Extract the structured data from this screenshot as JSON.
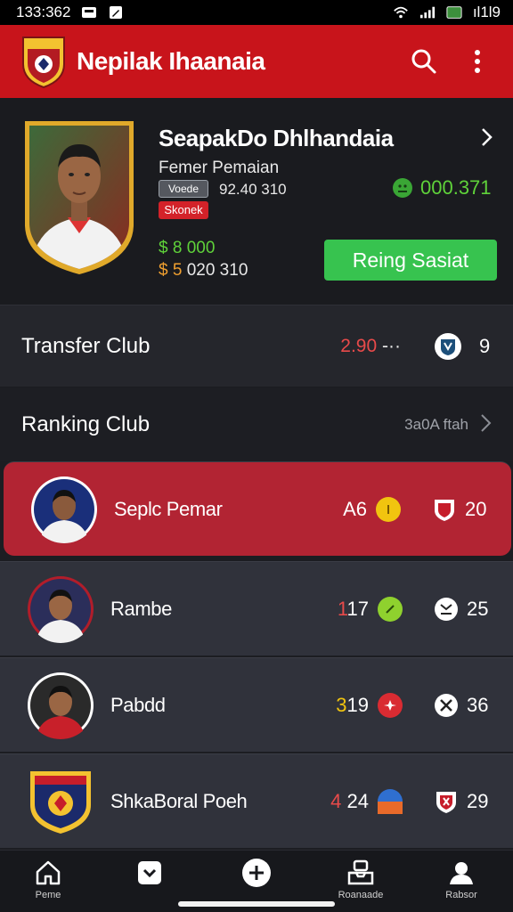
{
  "status_bar": {
    "time": "133:362",
    "right_text": "ıl1l9"
  },
  "app_bar": {
    "title": "Nepilak Ihaanaia"
  },
  "profile": {
    "name": "SeapakDo Dhlhandaia",
    "subtitle": "Femer Pemaian",
    "tag_grey": "Voede",
    "tag_value": "92.40 310",
    "tag_red": "Skonek",
    "money_green": "$ 8 000",
    "money_orange_lead": "$ 5",
    "money_orange_rest": "020 310",
    "balance": "000.371",
    "cta_label": "Reing Sasiat"
  },
  "transfer": {
    "label": "Transfer Club",
    "value": "2.90",
    "value_suffix": " -··",
    "count": "9"
  },
  "ranking": {
    "label": "Ranking Club",
    "link": "3a0A ftah",
    "rows": [
      {
        "name": "Seplc Pemar",
        "score_lead": "A",
        "score_rest": "6",
        "dot_color": "#f1c40f",
        "points": "20"
      },
      {
        "name": "Rambe",
        "score_lead": "1",
        "score_rest": "17",
        "dot_color": "#8fd12e",
        "points": "25"
      },
      {
        "name": "Pabdd",
        "score_lead": "3",
        "score_rest": "19",
        "dot_color": "#d92b32",
        "points": "36"
      },
      {
        "name": "ShkaBoral Poeh",
        "score_lead": "4",
        "score_rest": "24",
        "dot_color": "#2f6fd0",
        "points": "29"
      }
    ]
  },
  "nav": {
    "home": "Peme",
    "cards": "",
    "add": "",
    "transfer": "Roanaade",
    "profile": "Rabsor"
  }
}
